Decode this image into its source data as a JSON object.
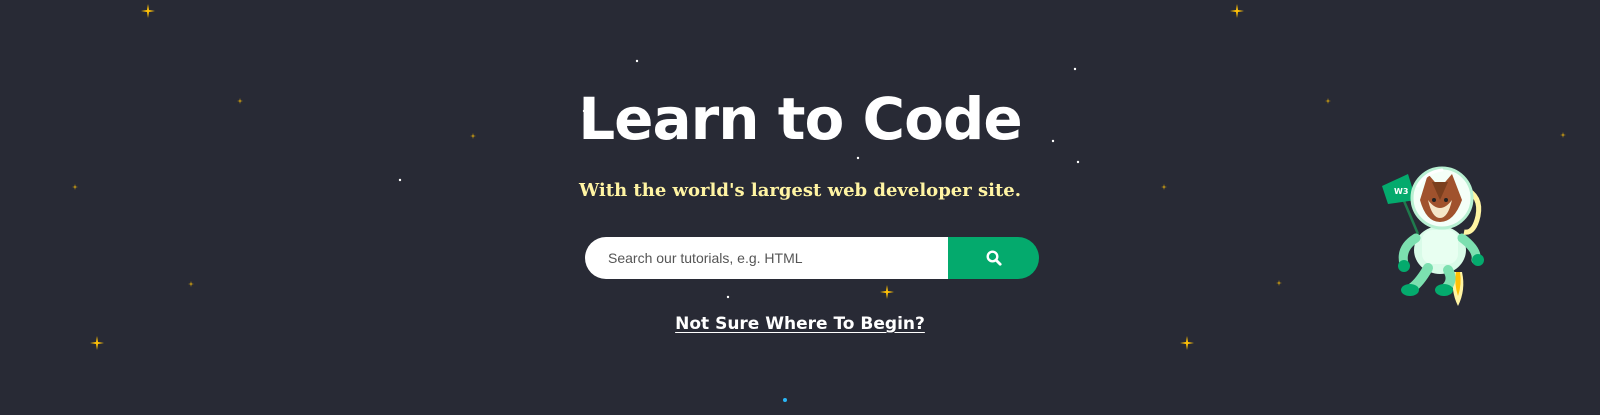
{
  "hero": {
    "title": "Learn to Code",
    "subtitle": "With the world's largest web developer site."
  },
  "search": {
    "placeholder": "Search our tutorials, e.g. HTML",
    "button_icon": "search-icon"
  },
  "links": {
    "not_sure": "Not Sure Where To Begin?"
  },
  "mascot": {
    "flag_text": "W3"
  },
  "colors": {
    "background": "#282a35",
    "title": "#ffffff",
    "subtitle": "#fff4a3",
    "accent": "#04aa6d",
    "star": "#ffc107"
  }
}
